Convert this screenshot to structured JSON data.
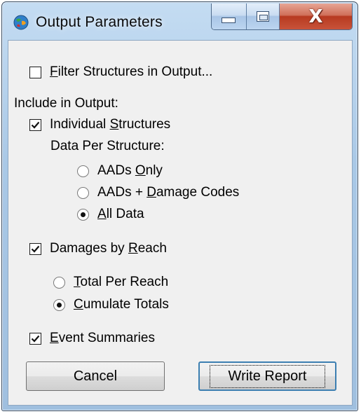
{
  "window": {
    "title": "Output Parameters"
  },
  "caption_buttons": {
    "close_glyph": "X"
  },
  "filter": {
    "pre": "",
    "mnemonic": "F",
    "rest": "ilter Structures in Output...",
    "checked": false
  },
  "include_label": "Include in Output:",
  "individual": {
    "pre": "Individual ",
    "mnemonic": "S",
    "rest": "tructures",
    "checked": true
  },
  "data_per_structure": "Data Per Structure:",
  "structure_options": [
    {
      "pre": "AADs ",
      "mnemonic": "O",
      "rest": "nly",
      "selected": false
    },
    {
      "pre": "AADs + ",
      "mnemonic": "D",
      "rest": "amage Codes",
      "selected": false
    },
    {
      "pre": "",
      "mnemonic": "A",
      "rest": "ll Data",
      "selected": true
    }
  ],
  "damages": {
    "pre": "Damages by ",
    "mnemonic": "R",
    "rest": "each",
    "checked": true
  },
  "reach_options": [
    {
      "pre": "",
      "mnemonic": "T",
      "rest": "otal Per Reach",
      "selected": false
    },
    {
      "pre": "",
      "mnemonic": "C",
      "rest": "umulate Totals",
      "selected": true
    }
  ],
  "events": {
    "pre": "",
    "mnemonic": "E",
    "rest": "vent Summaries",
    "checked": true
  },
  "buttons": {
    "cancel": "Cancel",
    "write_report": "Write Report"
  }
}
